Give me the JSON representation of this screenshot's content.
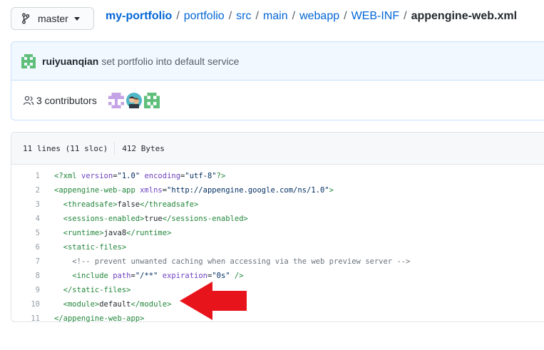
{
  "branch": {
    "label": "master",
    "icon": "git-branch-icon"
  },
  "breadcrumb": {
    "repo": "my-portfolio",
    "sep": "/",
    "parts": [
      "portfolio",
      "src",
      "main",
      "webapp",
      "WEB-INF"
    ],
    "file": "appengine-web.xml"
  },
  "commit": {
    "author": "ruiyuanqian",
    "message": "set portfolio into default service",
    "avatar_icon": "identicon-avatar"
  },
  "contributors": {
    "text": "3 contributors",
    "icon": "people-icon",
    "avatars": [
      "contributor-avatar-1",
      "contributor-avatar-2",
      "contributor-avatar-3"
    ]
  },
  "file_info": {
    "lines": "11 lines (11 sloc)",
    "size": "412 Bytes"
  },
  "code": [
    {
      "n": "1",
      "tokens": [
        [
          "tag",
          "<?xml "
        ],
        [
          "attr",
          "version"
        ],
        [
          "plain",
          "="
        ],
        [
          "str",
          "\"1.0\""
        ],
        [
          "plain",
          " "
        ],
        [
          "attr",
          "encoding"
        ],
        [
          "plain",
          "="
        ],
        [
          "str",
          "\"utf-8\""
        ],
        [
          "tag",
          "?>"
        ]
      ]
    },
    {
      "n": "2",
      "tokens": [
        [
          "tag",
          "<appengine-web-app "
        ],
        [
          "attr",
          "xmlns"
        ],
        [
          "plain",
          "="
        ],
        [
          "str",
          "\"http://appengine.google.com/ns/1.0\""
        ],
        [
          "tag",
          ">"
        ]
      ]
    },
    {
      "n": "3",
      "tokens": [
        [
          "plain",
          "  "
        ],
        [
          "tag",
          "<threadsafe>"
        ],
        [
          "plain",
          "false"
        ],
        [
          "tag",
          "</threadsafe>"
        ]
      ]
    },
    {
      "n": "4",
      "tokens": [
        [
          "plain",
          "  "
        ],
        [
          "tag",
          "<sessions-enabled>"
        ],
        [
          "plain",
          "true"
        ],
        [
          "tag",
          "</sessions-enabled>"
        ]
      ]
    },
    {
      "n": "5",
      "tokens": [
        [
          "plain",
          "  "
        ],
        [
          "tag",
          "<runtime>"
        ],
        [
          "plain",
          "java8"
        ],
        [
          "tag",
          "</runtime>"
        ]
      ]
    },
    {
      "n": "6",
      "tokens": [
        [
          "plain",
          "  "
        ],
        [
          "tag",
          "<static-files>"
        ]
      ]
    },
    {
      "n": "7",
      "tokens": [
        [
          "plain",
          "    "
        ],
        [
          "cmt",
          "<!-- prevent unwanted caching when accessing via the web preview server -->"
        ]
      ]
    },
    {
      "n": "8",
      "tokens": [
        [
          "plain",
          "    "
        ],
        [
          "tag",
          "<include "
        ],
        [
          "attr",
          "path"
        ],
        [
          "plain",
          "="
        ],
        [
          "str",
          "\"/**\""
        ],
        [
          "plain",
          " "
        ],
        [
          "attr",
          "expiration"
        ],
        [
          "plain",
          "="
        ],
        [
          "str",
          "\"0s\""
        ],
        [
          "tag",
          " />"
        ]
      ]
    },
    {
      "n": "9",
      "tokens": [
        [
          "plain",
          "  "
        ],
        [
          "tag",
          "</static-files>"
        ]
      ]
    },
    {
      "n": "10",
      "tokens": [
        [
          "plain",
          "  "
        ],
        [
          "tag",
          "<module>"
        ],
        [
          "plain",
          "default"
        ],
        [
          "tag",
          "</module>"
        ]
      ]
    },
    {
      "n": "11",
      "tokens": [
        [
          "tag",
          "</appengine-web-app>"
        ]
      ]
    }
  ],
  "annotation": {
    "arrow_color": "#e8141c",
    "arrow_target_line": "10"
  },
  "colors": {
    "link": "#0366d6",
    "tag": "#22863a",
    "attr": "#6f42c1",
    "string": "#032f62",
    "comment": "#6a737d"
  }
}
